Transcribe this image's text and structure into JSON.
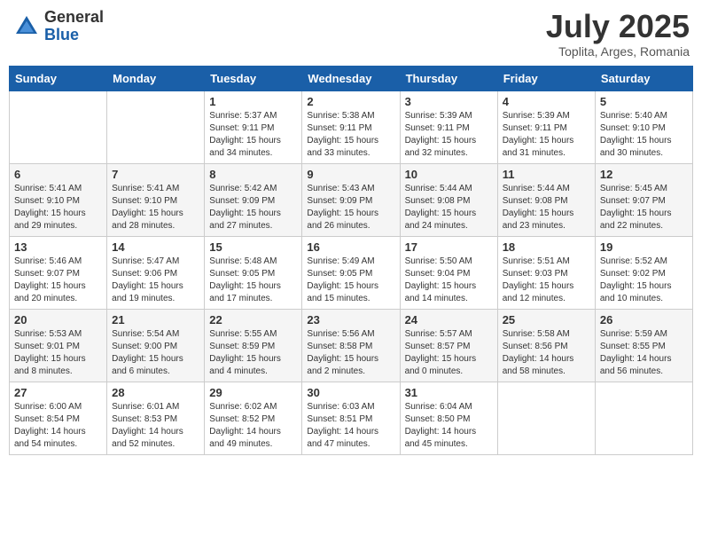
{
  "header": {
    "logo_general": "General",
    "logo_blue": "Blue",
    "month_title": "July 2025",
    "location": "Toplita, Arges, Romania"
  },
  "days_of_week": [
    "Sunday",
    "Monday",
    "Tuesday",
    "Wednesday",
    "Thursday",
    "Friday",
    "Saturday"
  ],
  "weeks": [
    [
      {
        "day": "",
        "info": ""
      },
      {
        "day": "",
        "info": ""
      },
      {
        "day": "1",
        "info": "Sunrise: 5:37 AM\nSunset: 9:11 PM\nDaylight: 15 hours\nand 34 minutes."
      },
      {
        "day": "2",
        "info": "Sunrise: 5:38 AM\nSunset: 9:11 PM\nDaylight: 15 hours\nand 33 minutes."
      },
      {
        "day": "3",
        "info": "Sunrise: 5:39 AM\nSunset: 9:11 PM\nDaylight: 15 hours\nand 32 minutes."
      },
      {
        "day": "4",
        "info": "Sunrise: 5:39 AM\nSunset: 9:11 PM\nDaylight: 15 hours\nand 31 minutes."
      },
      {
        "day": "5",
        "info": "Sunrise: 5:40 AM\nSunset: 9:10 PM\nDaylight: 15 hours\nand 30 minutes."
      }
    ],
    [
      {
        "day": "6",
        "info": "Sunrise: 5:41 AM\nSunset: 9:10 PM\nDaylight: 15 hours\nand 29 minutes."
      },
      {
        "day": "7",
        "info": "Sunrise: 5:41 AM\nSunset: 9:10 PM\nDaylight: 15 hours\nand 28 minutes."
      },
      {
        "day": "8",
        "info": "Sunrise: 5:42 AM\nSunset: 9:09 PM\nDaylight: 15 hours\nand 27 minutes."
      },
      {
        "day": "9",
        "info": "Sunrise: 5:43 AM\nSunset: 9:09 PM\nDaylight: 15 hours\nand 26 minutes."
      },
      {
        "day": "10",
        "info": "Sunrise: 5:44 AM\nSunset: 9:08 PM\nDaylight: 15 hours\nand 24 minutes."
      },
      {
        "day": "11",
        "info": "Sunrise: 5:44 AM\nSunset: 9:08 PM\nDaylight: 15 hours\nand 23 minutes."
      },
      {
        "day": "12",
        "info": "Sunrise: 5:45 AM\nSunset: 9:07 PM\nDaylight: 15 hours\nand 22 minutes."
      }
    ],
    [
      {
        "day": "13",
        "info": "Sunrise: 5:46 AM\nSunset: 9:07 PM\nDaylight: 15 hours\nand 20 minutes."
      },
      {
        "day": "14",
        "info": "Sunrise: 5:47 AM\nSunset: 9:06 PM\nDaylight: 15 hours\nand 19 minutes."
      },
      {
        "day": "15",
        "info": "Sunrise: 5:48 AM\nSunset: 9:05 PM\nDaylight: 15 hours\nand 17 minutes."
      },
      {
        "day": "16",
        "info": "Sunrise: 5:49 AM\nSunset: 9:05 PM\nDaylight: 15 hours\nand 15 minutes."
      },
      {
        "day": "17",
        "info": "Sunrise: 5:50 AM\nSunset: 9:04 PM\nDaylight: 15 hours\nand 14 minutes."
      },
      {
        "day": "18",
        "info": "Sunrise: 5:51 AM\nSunset: 9:03 PM\nDaylight: 15 hours\nand 12 minutes."
      },
      {
        "day": "19",
        "info": "Sunrise: 5:52 AM\nSunset: 9:02 PM\nDaylight: 15 hours\nand 10 minutes."
      }
    ],
    [
      {
        "day": "20",
        "info": "Sunrise: 5:53 AM\nSunset: 9:01 PM\nDaylight: 15 hours\nand 8 minutes."
      },
      {
        "day": "21",
        "info": "Sunrise: 5:54 AM\nSunset: 9:00 PM\nDaylight: 15 hours\nand 6 minutes."
      },
      {
        "day": "22",
        "info": "Sunrise: 5:55 AM\nSunset: 8:59 PM\nDaylight: 15 hours\nand 4 minutes."
      },
      {
        "day": "23",
        "info": "Sunrise: 5:56 AM\nSunset: 8:58 PM\nDaylight: 15 hours\nand 2 minutes."
      },
      {
        "day": "24",
        "info": "Sunrise: 5:57 AM\nSunset: 8:57 PM\nDaylight: 15 hours\nand 0 minutes."
      },
      {
        "day": "25",
        "info": "Sunrise: 5:58 AM\nSunset: 8:56 PM\nDaylight: 14 hours\nand 58 minutes."
      },
      {
        "day": "26",
        "info": "Sunrise: 5:59 AM\nSunset: 8:55 PM\nDaylight: 14 hours\nand 56 minutes."
      }
    ],
    [
      {
        "day": "27",
        "info": "Sunrise: 6:00 AM\nSunset: 8:54 PM\nDaylight: 14 hours\nand 54 minutes."
      },
      {
        "day": "28",
        "info": "Sunrise: 6:01 AM\nSunset: 8:53 PM\nDaylight: 14 hours\nand 52 minutes."
      },
      {
        "day": "29",
        "info": "Sunrise: 6:02 AM\nSunset: 8:52 PM\nDaylight: 14 hours\nand 49 minutes."
      },
      {
        "day": "30",
        "info": "Sunrise: 6:03 AM\nSunset: 8:51 PM\nDaylight: 14 hours\nand 47 minutes."
      },
      {
        "day": "31",
        "info": "Sunrise: 6:04 AM\nSunset: 8:50 PM\nDaylight: 14 hours\nand 45 minutes."
      },
      {
        "day": "",
        "info": ""
      },
      {
        "day": "",
        "info": ""
      }
    ]
  ]
}
